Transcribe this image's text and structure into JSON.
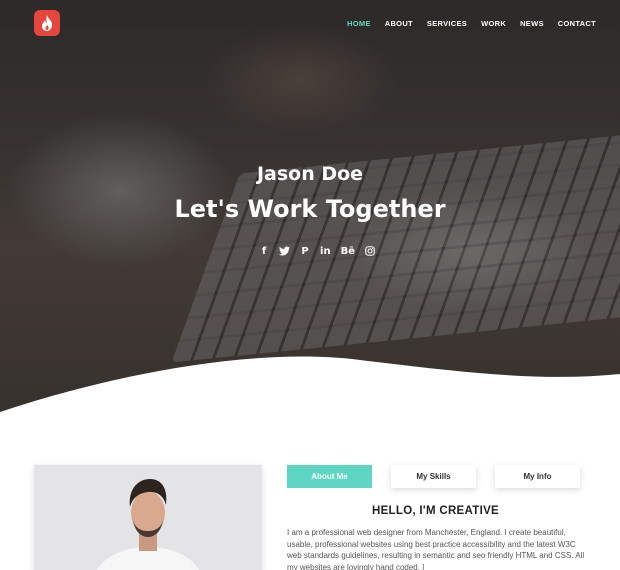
{
  "nav": {
    "items": [
      {
        "label": "HOME",
        "active": true
      },
      {
        "label": "ABOUT",
        "active": false
      },
      {
        "label": "SERVICES",
        "active": false
      },
      {
        "label": "WORK",
        "active": false
      },
      {
        "label": "NEWS",
        "active": false
      },
      {
        "label": "CONTACT",
        "active": false
      }
    ]
  },
  "hero": {
    "name": "Jason Doe",
    "title": "Let's Work Together",
    "social": [
      {
        "icon": "facebook-icon",
        "glyph": "f"
      },
      {
        "icon": "twitter-icon",
        "glyph": "🐦"
      },
      {
        "icon": "pinterest-icon",
        "glyph": "P"
      },
      {
        "icon": "linkedin-icon",
        "glyph": "in"
      },
      {
        "icon": "behance-icon",
        "glyph": "Bē"
      },
      {
        "icon": "instagram-icon",
        "glyph": "◎"
      }
    ]
  },
  "about": {
    "tabs": [
      {
        "label": "About Me",
        "active": true
      },
      {
        "label": "My Skills",
        "active": false
      },
      {
        "label": "My Info",
        "active": false
      }
    ],
    "heading": "HELLO, I'M CREATIVE",
    "text": "I am a professional web designer from Manchester, England. I create beautiful, usable, professional websites using best practice accessibility and the latest W3C web standards guidelines, resulting in semantic and seo friendly HTML and CSS. All my websites are lovingly hand coded. I"
  },
  "colors": {
    "accent": "#5fd6c4",
    "logo": "#e5473f"
  }
}
